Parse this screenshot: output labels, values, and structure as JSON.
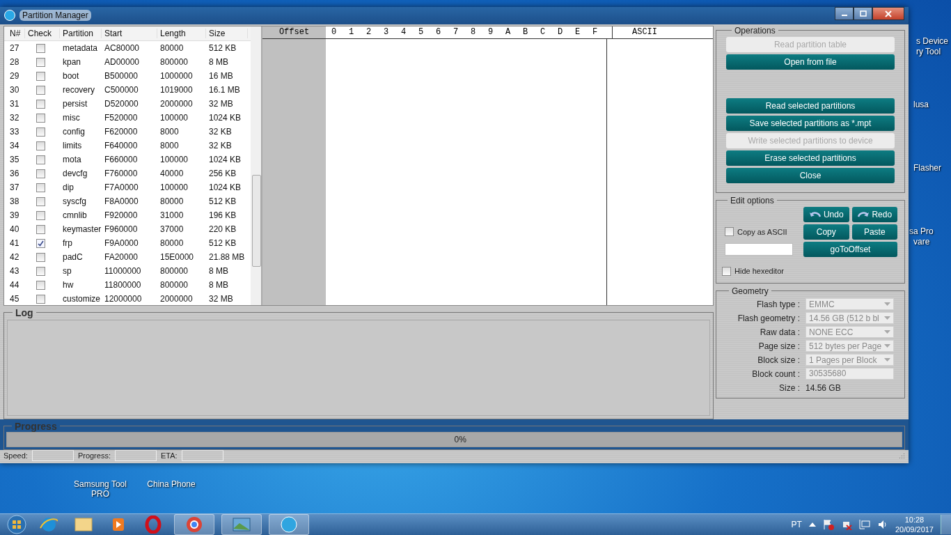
{
  "window": {
    "title": "Partition Manager"
  },
  "table": {
    "columns": [
      "N#",
      "Check",
      "Partition",
      "Start",
      "Length",
      "Size"
    ],
    "rows": [
      {
        "n": "27",
        "checked": false,
        "partition": "metadata",
        "start": "AC80000",
        "length": "80000",
        "size": "512 KB"
      },
      {
        "n": "28",
        "checked": false,
        "partition": "kpan",
        "start": "AD00000",
        "length": "800000",
        "size": "8 MB"
      },
      {
        "n": "29",
        "checked": false,
        "partition": "boot",
        "start": "B500000",
        "length": "1000000",
        "size": "16 MB"
      },
      {
        "n": "30",
        "checked": false,
        "partition": "recovery",
        "start": "C500000",
        "length": "1019000",
        "size": "16.1 MB"
      },
      {
        "n": "31",
        "checked": false,
        "partition": "persist",
        "start": "D520000",
        "length": "2000000",
        "size": "32 MB"
      },
      {
        "n": "32",
        "checked": false,
        "partition": "misc",
        "start": "F520000",
        "length": "100000",
        "size": "1024 KB"
      },
      {
        "n": "33",
        "checked": false,
        "partition": "config",
        "start": "F620000",
        "length": "8000",
        "size": "32 KB"
      },
      {
        "n": "34",
        "checked": false,
        "partition": "limits",
        "start": "F640000",
        "length": "8000",
        "size": "32 KB"
      },
      {
        "n": "35",
        "checked": false,
        "partition": "mota",
        "start": "F660000",
        "length": "100000",
        "size": "1024 KB"
      },
      {
        "n": "36",
        "checked": false,
        "partition": "devcfg",
        "start": "F760000",
        "length": "40000",
        "size": "256 KB"
      },
      {
        "n": "37",
        "checked": false,
        "partition": "dip",
        "start": "F7A0000",
        "length": "100000",
        "size": "1024 KB"
      },
      {
        "n": "38",
        "checked": false,
        "partition": "syscfg",
        "start": "F8A0000",
        "length": "80000",
        "size": "512 KB"
      },
      {
        "n": "39",
        "checked": false,
        "partition": "cmnlib",
        "start": "F920000",
        "length": "31000",
        "size": "196 KB"
      },
      {
        "n": "40",
        "checked": false,
        "partition": "keymaster",
        "start": "F960000",
        "length": "37000",
        "size": "220 KB"
      },
      {
        "n": "41",
        "checked": true,
        "partition": "frp",
        "start": "F9A0000",
        "length": "80000",
        "size": "512 KB"
      },
      {
        "n": "42",
        "checked": false,
        "partition": "padC",
        "start": "FA20000",
        "length": "15E0000",
        "size": "21.88 MB"
      },
      {
        "n": "43",
        "checked": false,
        "partition": "sp",
        "start": "11000000",
        "length": "800000",
        "size": "8 MB"
      },
      {
        "n": "44",
        "checked": false,
        "partition": "hw",
        "start": "11800000",
        "length": "800000",
        "size": "8 MB"
      },
      {
        "n": "45",
        "checked": false,
        "partition": "customize",
        "start": "12000000",
        "length": "2000000",
        "size": "32 MB"
      }
    ]
  },
  "hex_editor": {
    "offset_header": "Offset",
    "columns": [
      "0",
      "1",
      "2",
      "3",
      "4",
      "5",
      "6",
      "7",
      "8",
      "9",
      "A",
      "B",
      "C",
      "D",
      "E",
      "F"
    ],
    "ascii_header": "ASCII"
  },
  "operations": {
    "title": "Operations",
    "buttons": [
      {
        "label": "Read partition table",
        "disabled": true
      },
      {
        "label": "Open from file",
        "disabled": false
      },
      {
        "label": "Read selected partitions",
        "disabled": false
      },
      {
        "label": "Save selected partitions as *.mpt",
        "disabled": false
      },
      {
        "label": "Write selected partitions to device",
        "disabled": true
      },
      {
        "label": "Erase selected partitions",
        "disabled": false
      },
      {
        "label": "Close",
        "disabled": false
      }
    ]
  },
  "edit_options": {
    "title": "Edit options",
    "undo": "Undo",
    "redo": "Redo",
    "copy": "Copy",
    "paste": "Paste",
    "goto": "goToOffset",
    "copy_as_ascii": {
      "label": "Copy as ASCII",
      "checked": false
    },
    "hide_hexeditor": {
      "label": "Hide hexeditor",
      "checked": false
    }
  },
  "log": {
    "title": "Log"
  },
  "geometry": {
    "title": "Geometry",
    "fields": [
      {
        "label": "Flash type :",
        "value": "EMMC",
        "kind": "dropdown"
      },
      {
        "label": "Flash geometry :",
        "value": "14.56 GB (512 b bl",
        "kind": "dropdown"
      },
      {
        "label": "Raw data :",
        "value": "NONE ECC",
        "kind": "dropdown"
      },
      {
        "label": "Page size :",
        "value": "512 bytes per Page",
        "kind": "dropdown"
      },
      {
        "label": "Block size :",
        "value": "1 Pages per Block",
        "kind": "dropdown"
      },
      {
        "label": "Block count :",
        "value": "30535680",
        "kind": "field"
      },
      {
        "label": "Size :",
        "value": "14.56 GB",
        "kind": "plain"
      }
    ]
  },
  "progress": {
    "title": "Progress",
    "level": 0,
    "reading": "0%"
  },
  "status_bar": [
    "Speed:",
    "Progress:",
    "ETA:"
  ],
  "desktop_icons": [
    {
      "label": "Samsung Tool PRO"
    },
    {
      "label": "China Phone"
    }
  ],
  "desktop_partial_labels": [
    "s Device",
    "ry Tool",
    "lusa",
    "Flasher",
    "sa Pro",
    "vare"
  ],
  "taskbar": {
    "language": "PT",
    "time": "10:28",
    "date": "20/09/2017"
  }
}
